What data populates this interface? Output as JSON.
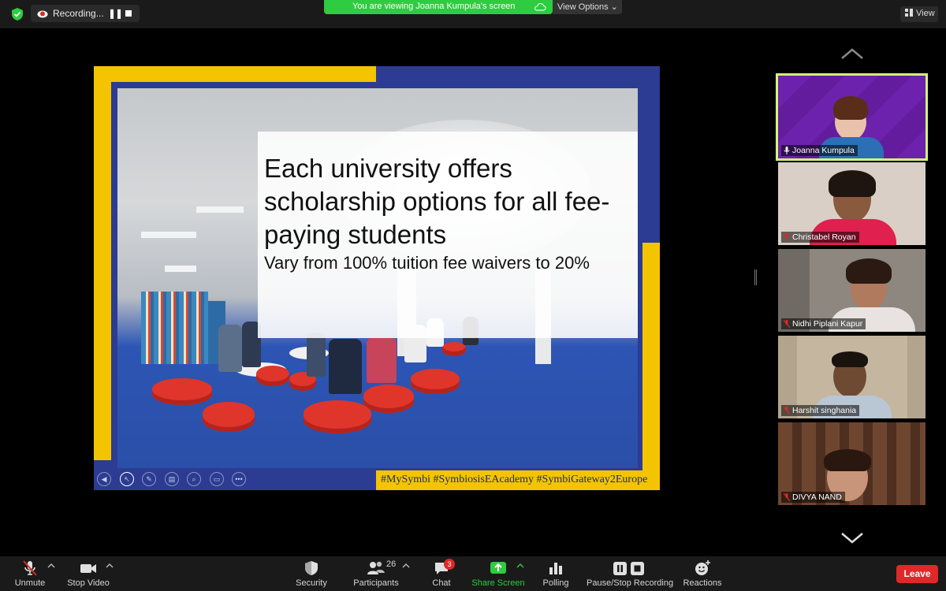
{
  "top_bar": {
    "recording_label": "Recording...",
    "pause_glyph": "❚❚",
    "viewing_text": "You are viewing Joanna Kumpula's screen",
    "view_options_label": "View Options ⌄",
    "view_label": "View"
  },
  "slide": {
    "title": "Each university offers scholarship options for all fee-paying students",
    "subtitle": "Vary from 100% tuition fee waivers to 20%",
    "hashtags": "#MySymbi #SymbiosisEAcademy #SymbiGateway2Europe",
    "tools": [
      "◀",
      "↖",
      "✎",
      "▤",
      "⌕",
      "▭",
      "•••"
    ]
  },
  "participants": [
    {
      "name": "Joanna Kumpula",
      "muted": false,
      "active_speaker": true
    },
    {
      "name": "Christabel Royan",
      "muted": true,
      "active_speaker": false
    },
    {
      "name": "Nidhi Piplani Kapur",
      "muted": true,
      "active_speaker": false
    },
    {
      "name": "Harshit singhania",
      "muted": true,
      "active_speaker": false
    },
    {
      "name": "DIVYA NAND",
      "muted": true,
      "active_speaker": false
    }
  ],
  "toolbar": {
    "unmute": "Unmute",
    "stop_video": "Stop Video",
    "security": "Security",
    "participants": "Participants",
    "participants_count": "26",
    "chat": "Chat",
    "chat_badge": "3",
    "share_screen": "Share Screen",
    "polling": "Polling",
    "pause_stop_recording": "Pause/Stop Recording",
    "reactions": "Reactions",
    "leave": "Leave"
  },
  "colors": {
    "accent_green": "#2ecc40",
    "leave_red": "#e02828",
    "active_speaker_outline": "#d4f57a",
    "slide_blue": "#2c3c92",
    "slide_yellow": "#f5c400"
  }
}
